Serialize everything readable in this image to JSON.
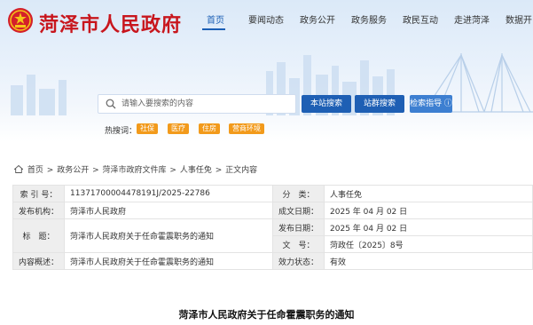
{
  "site": {
    "title": "菏泽市人民政府"
  },
  "nav": {
    "items": [
      {
        "label": "首页",
        "active": true
      },
      {
        "label": "要闻动态"
      },
      {
        "label": "政务公开"
      },
      {
        "label": "政务服务"
      },
      {
        "label": "政民互动"
      },
      {
        "label": "走进菏泽"
      },
      {
        "label": "数据开"
      }
    ]
  },
  "search": {
    "placeholder": "请输入要搜索的内容",
    "site_button": "本站搜索",
    "cluster_button": "站群搜索",
    "guide_button": "检索指导 ⓘ",
    "hot_label": "热搜词：",
    "hot_tags": [
      "社保",
      "医疗",
      "住房",
      "营商环境"
    ]
  },
  "breadcrumb": [
    "首页",
    "政务公开",
    "菏泽市政府文件库",
    "人事任免",
    "正文内容"
  ],
  "breadcrumb_sep": ">",
  "info": {
    "index_label": "索 引 号：",
    "index_value": "11371700004478191J/2025-22786",
    "category_label": "分　类：",
    "category_value": "人事任免",
    "publisher_label": "发布机构：",
    "publisher_value": "菏泽市人民政府",
    "created_label": "成文日期：",
    "created_value": "2025 年 04 月 02 日",
    "title_label": "标　题：",
    "title_value": "菏泽市人民政府关于任命霍震职务的通知",
    "published_label": "发布日期：",
    "published_value": "2025 年 04 月 02 日",
    "docno_label": "文　号：",
    "docno_value": "菏政任〔2025〕8号",
    "summary_label": "内容概述：",
    "summary_value": "菏泽市人民政府关于任命霍震职务的通知",
    "status_label": "效力状态：",
    "status_value": "有效"
  },
  "article": {
    "title": "菏泽市人民政府关于任命霍震职务的通知"
  },
  "colors": {
    "brand_red": "#c8161d",
    "nav_blue": "#1b5fb5",
    "button_blue": "#1e5fb4",
    "hot_orange": "#f29a1b"
  }
}
